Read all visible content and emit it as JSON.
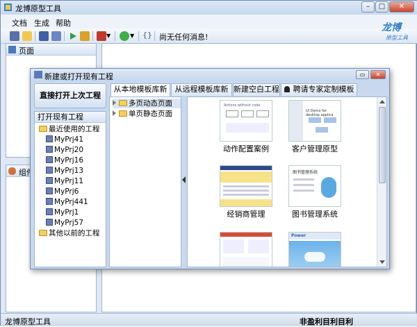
{
  "app": {
    "title": "龙博原型工具",
    "menu": [
      "文档",
      "生成",
      "帮助"
    ],
    "toolbar_message": "尚无任何消息!",
    "logo_text": "龙博",
    "logo_sub": "原型工具"
  },
  "panes": {
    "pages_label": "页面",
    "components_label": "组件"
  },
  "statusbar": {
    "left": "龙博原型工具",
    "right": "非盈利目利目利"
  },
  "dialog": {
    "title": "新建或打开现有工程",
    "open_last_button": "直接打开上次工程",
    "open_existing_label": "打开现有工程",
    "recent_label": "最近使用的工程",
    "recent_projects": [
      "MyPrj41",
      "MyPrj20",
      "MyPrj16",
      "MyPrj13",
      "MyPrj11",
      "MyPrj6",
      "MyPrj441",
      "MyPrj1",
      "MyPrj57"
    ],
    "older_label": "其他以前的工程",
    "tabs": [
      "从本地模板库新建",
      "从远程模板库新建",
      "新建空白工程",
      "聘请专家定制模板"
    ],
    "tree": [
      "多页动态页面",
      "单页静态页面"
    ],
    "templates": [
      "动作配置案例",
      "客户管理原型",
      "经销商管理",
      "图书管理系统"
    ],
    "thumb_texts": {
      "t1": "Actions without code",
      "t2": "UI Demo for desktop applica",
      "t4": "图书管理系统",
      "t6": "Power"
    }
  },
  "colors": {
    "accent": "#2f7fc4",
    "title_bg": "#dbe7f6",
    "pane_border": "#9cb3d1"
  }
}
